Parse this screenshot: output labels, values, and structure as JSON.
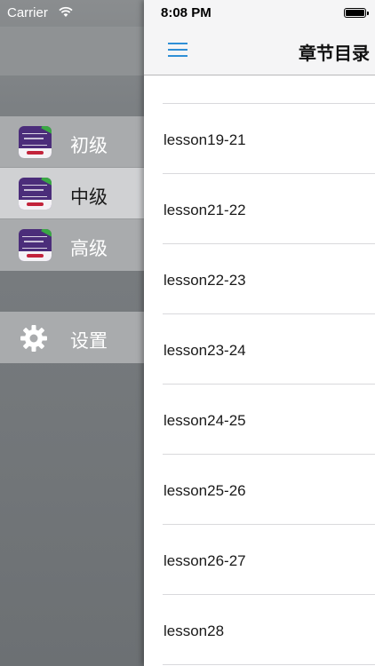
{
  "status_bar": {
    "carrier": "Carrier",
    "time": "8:08 PM",
    "battery_level": 1.0
  },
  "sidebar": {
    "items": [
      {
        "label": "初级",
        "icon": "book-cover-icon",
        "active": false
      },
      {
        "label": "中级",
        "icon": "book-cover-icon",
        "active": true
      },
      {
        "label": "高级",
        "icon": "book-cover-icon",
        "active": false
      }
    ],
    "settings": {
      "label": "设置",
      "icon": "gear-icon"
    }
  },
  "nav": {
    "title": "章节目录",
    "menu_icon": "hamburger-menu-icon"
  },
  "lessons": [
    "lesson19-21",
    "lesson21-22",
    "lesson22-23",
    "lesson23-24",
    "lesson24-25",
    "lesson25-26",
    "lesson26-27",
    "lesson28"
  ],
  "colors": {
    "accent": "#2f8fd6",
    "sidebar_bg": "#6c7073",
    "active_item_bg": "#d0d1d3",
    "book_cover": "#4b2d7a"
  }
}
